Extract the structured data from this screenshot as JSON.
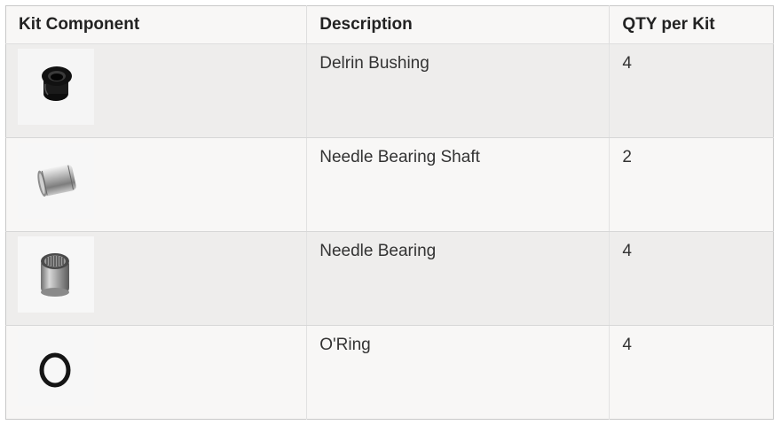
{
  "table": {
    "headers": {
      "component": "Kit Component",
      "description": "Description",
      "qty": "QTY per Kit"
    },
    "rows": [
      {
        "image": "delrin-bushing-photo",
        "description": "Delrin Bushing",
        "qty": "4"
      },
      {
        "image": "needle-bearing-shaft-photo",
        "description": "Needle Bearing Shaft",
        "qty": "2"
      },
      {
        "image": "needle-bearing-photo",
        "description": "Needle Bearing",
        "qty": "4"
      },
      {
        "image": "o-ring-photo",
        "description": "O'Ring",
        "qty": "4"
      }
    ]
  }
}
